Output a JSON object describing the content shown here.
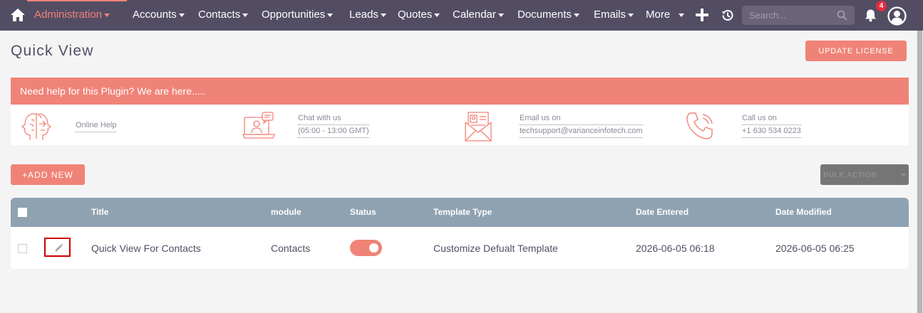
{
  "nav": {
    "items": [
      {
        "label": "Administration",
        "active": true
      },
      {
        "label": "Accounts"
      },
      {
        "label": "Contacts"
      },
      {
        "label": "Opportunities"
      },
      {
        "label": "Leads"
      },
      {
        "label": "Quotes"
      },
      {
        "label": "Calendar"
      },
      {
        "label": "Documents"
      },
      {
        "label": "Emails"
      },
      {
        "label": "More"
      }
    ],
    "search_placeholder": "Search...",
    "notification_count": "4",
    "colors": {
      "bar": "#534d64",
      "accent": "#f08377",
      "badge": "#e42c40"
    }
  },
  "page": {
    "title": "Quick View",
    "update_license": "UPDATE LICENSE"
  },
  "help": {
    "banner": "Need help for this Plugin? We are here.....",
    "online_help": "Online Help",
    "chat_title": "Chat with us",
    "chat_hours": "(05:00 - 13:00 GMT)",
    "email_title": "Email us on",
    "email_address": "techsupport@varianceinfotech.com",
    "call_title": "Call us on",
    "call_number": "+1 630 534 0223"
  },
  "actions": {
    "add_new": "+ADD NEW",
    "bulk_action": "BULK ACTION"
  },
  "table": {
    "columns": [
      "Title",
      "module",
      "Status",
      "Template Type",
      "Date Entered",
      "Date Modified"
    ],
    "rows": [
      {
        "title": "Quick View For Contacts",
        "module": "Contacts",
        "status_on": true,
        "template_type": "Customize Defualt Template",
        "date_entered": "2026-06-05 06:18",
        "date_modified": "2026-06-05 06:25"
      }
    ],
    "header_color": "#8ea2b2"
  }
}
